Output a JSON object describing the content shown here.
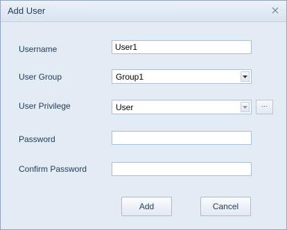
{
  "window": {
    "title": "Add User",
    "close_icon": "close-icon"
  },
  "form": {
    "username": {
      "label": "Username",
      "value": "User1"
    },
    "user_group": {
      "label": "User Group",
      "value": "Group1"
    },
    "user_privilege": {
      "label": "User Privilege",
      "value": "User",
      "more_label": "..."
    },
    "password": {
      "label": "Password",
      "value": ""
    },
    "confirm_password": {
      "label": "Confirm Password",
      "value": ""
    }
  },
  "buttons": {
    "add": "Add",
    "cancel": "Cancel"
  },
  "colors": {
    "dialog_bg": "#e3ebf4",
    "panel_bg": "#eef3f9",
    "border": "#8fa2b8",
    "text": "#1e3a5c"
  }
}
